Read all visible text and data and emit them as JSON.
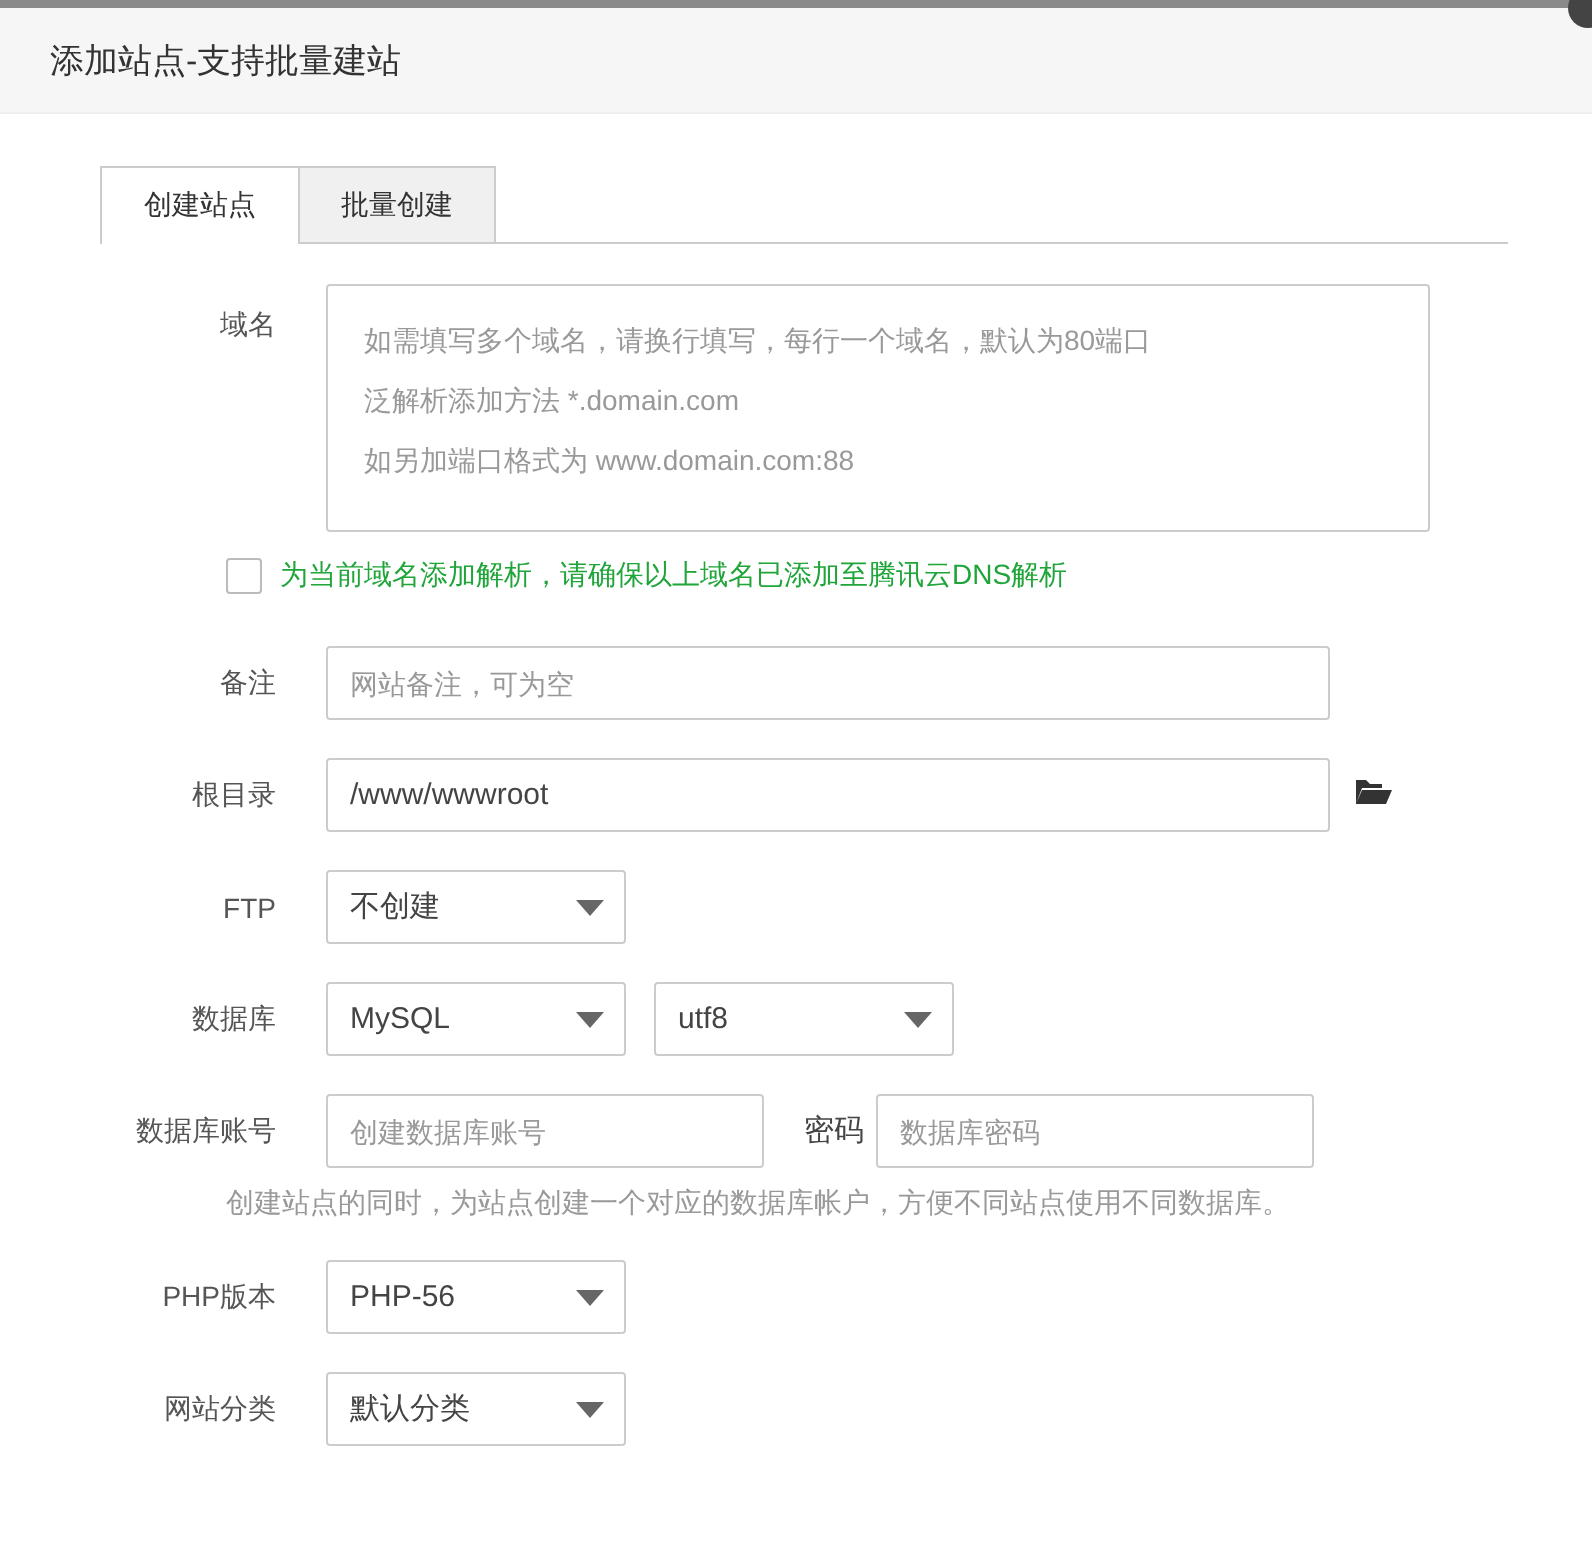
{
  "dialog": {
    "title": "添加站点-支持批量建站"
  },
  "tabs": [
    {
      "label": "创建站点",
      "selected": true
    },
    {
      "label": "批量创建",
      "selected": false
    }
  ],
  "form": [
    {
      "kind": "textarea",
      "label": "域名",
      "placeholder": [
        "如需填写多个域名，请换行填写，每行一个域名，默认为80端口",
        "泛解析添加方法 *.domain.com",
        "如另加端口格式为 www.domain.com:88"
      ]
    },
    {
      "kind": "checkbox",
      "checked": false,
      "text": "为当前域名添加解析，请确保以上域名已添加至腾讯云DNS解析"
    },
    {
      "kind": "input",
      "label": "备注",
      "placeholder": "网站备注，可为空"
    },
    {
      "kind": "path",
      "label": "根目录",
      "value": "/www/wwwroot"
    },
    {
      "kind": "select",
      "label": "FTP",
      "selects": [
        "不创建"
      ]
    },
    {
      "kind": "select",
      "label": "数据库",
      "selects": [
        "MySQL",
        "utf8"
      ]
    },
    {
      "kind": "account",
      "label": "数据库账号",
      "placeholder": "创建数据库账号",
      "password_label": "密码",
      "password_placeholder": "数据库密码"
    },
    {
      "kind": "hint",
      "text": "创建站点的同时，为站点创建一个对应的数据库帐户，方便不同站点使用不同数据库。"
    },
    {
      "kind": "select",
      "label": "PHP版本",
      "selects": [
        "PHP-56"
      ]
    },
    {
      "kind": "select",
      "label": "网站分类",
      "selects": [
        "默认分类"
      ]
    }
  ]
}
